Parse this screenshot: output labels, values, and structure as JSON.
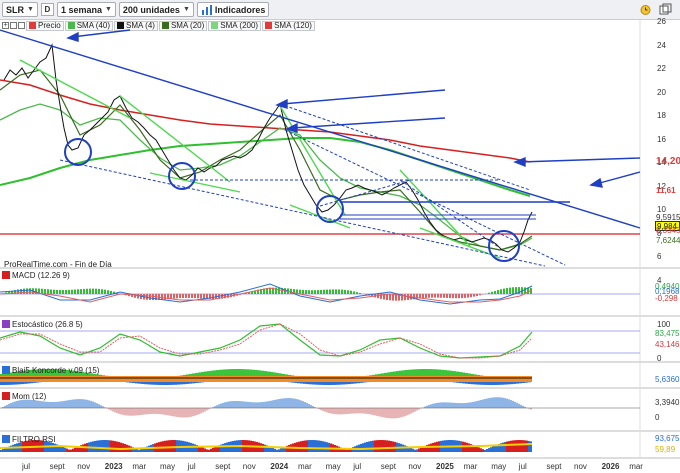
{
  "toolbar": {
    "symbol": "SLR",
    "draw_label": "D",
    "period": "1 semana",
    "units": "200 unidades",
    "indicators": "Indicadores"
  },
  "legend": [
    {
      "label": "Precio",
      "color": "#e03a3a"
    },
    {
      "label": "SMA (40)",
      "color": "#4cb84c"
    },
    {
      "label": "SMA (4)",
      "color": "#111111"
    },
    {
      "label": "SMA (20)",
      "color": "#3a6b1f"
    },
    {
      "label": "SMA (200)",
      "color": "#7fd47f"
    },
    {
      "label": "SMA (120)",
      "color": "#e03a3a"
    }
  ],
  "source_label": "ProRealTime.com - Fin de Día",
  "price_axis": [
    "26",
    "24",
    "22",
    "20",
    "18",
    "16",
    "14",
    "12",
    "10",
    "8",
    "6",
    "4"
  ],
  "price_tags": [
    {
      "text": "14,20",
      "color": "#e03a3a",
      "style": "red-text"
    },
    {
      "text": "11,61",
      "color": "#e03a3a",
      "style": "red-text"
    },
    {
      "text": "9,984",
      "color": "#111111",
      "style": "highlight"
    },
    {
      "text": "9,5915",
      "color": "#333333",
      "style": "text"
    },
    {
      "text": "8,3343",
      "color": "#e03a3a",
      "style": "text"
    },
    {
      "text": "7,6244",
      "color": "#3a6b1f",
      "style": "text"
    }
  ],
  "panels": [
    {
      "title": "MACD (12.26 9)",
      "values": [
        "0,4940",
        "0,1968",
        "-0,298"
      ],
      "value_colors": [
        "#28a745",
        "#2a6fd6",
        "#d43a3a"
      ]
    },
    {
      "title": "Estocástico (26.8 5)",
      "axis": [
        "100",
        "0"
      ],
      "values": [
        "83,475",
        "43,146"
      ],
      "value_colors": [
        "#28a745",
        "#d43a3a"
      ]
    },
    {
      "title": "Blai5 Koncorde v.09 (15)",
      "values": [
        "5,6360"
      ],
      "value_colors": [
        "#2a6fd6"
      ]
    },
    {
      "title": "Mom (12)",
      "values": [
        "3,3940",
        "0"
      ],
      "value_colors": [
        "#333333",
        "#333333"
      ]
    },
    {
      "title": "FILTRO RSI",
      "values": [
        "93,675",
        "59,89"
      ],
      "value_colors": [
        "#2a6fd6",
        "#e0b000"
      ]
    }
  ],
  "x_axis": [
    "jul",
    "sept",
    "nov",
    "2023",
    "mar",
    "may",
    "jul",
    "sept",
    "nov",
    "2024",
    "mar",
    "may",
    "jul",
    "sept",
    "nov",
    "2025",
    "mar",
    "may",
    "jul",
    "sept",
    "nov",
    "2026",
    "mar"
  ]
}
